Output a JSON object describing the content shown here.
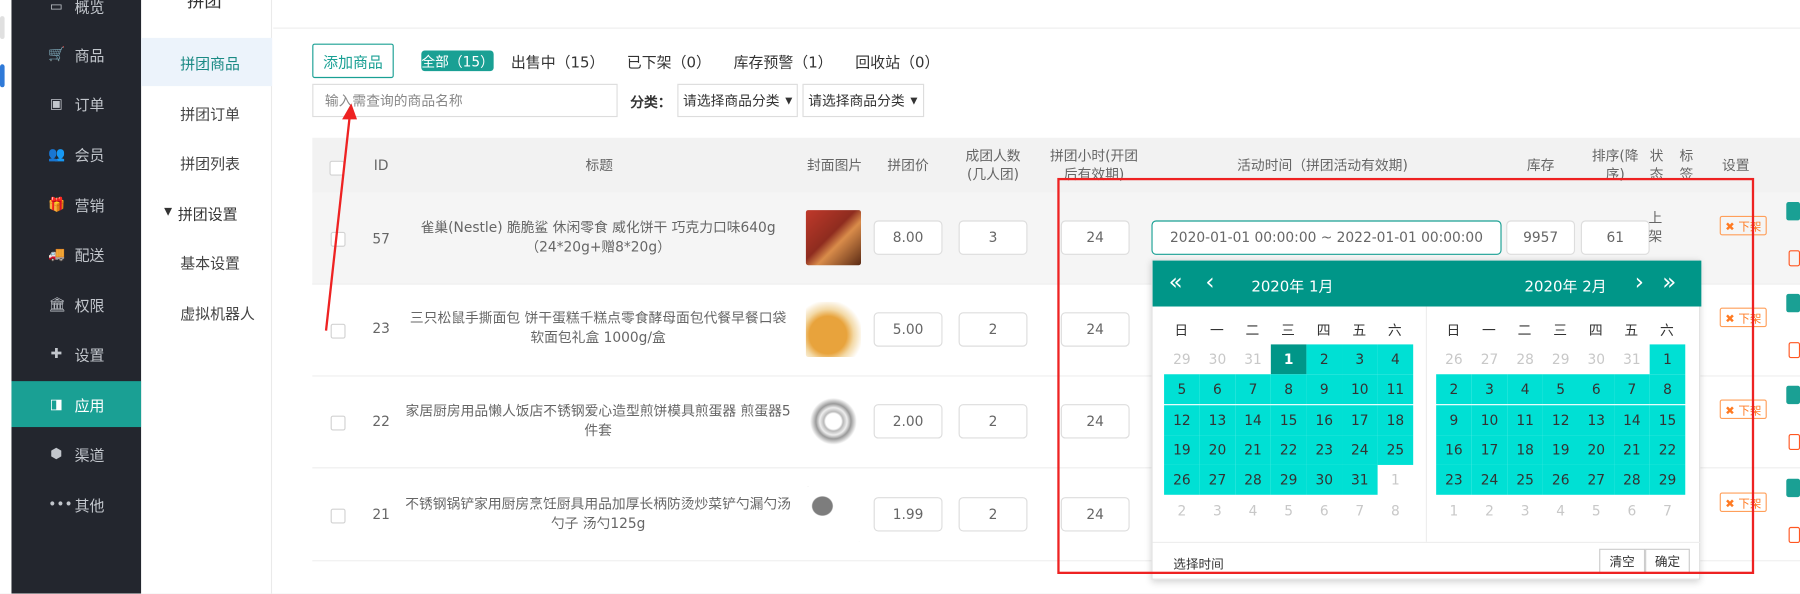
{
  "sidebar": {
    "items": [
      {
        "label": "概览",
        "icon": "monitor-icon",
        "active": false
      },
      {
        "label": "商品",
        "icon": "cart-icon",
        "active": false
      },
      {
        "label": "订单",
        "icon": "money-icon",
        "active": false
      },
      {
        "label": "会员",
        "icon": "users-icon",
        "active": false
      },
      {
        "label": "营销",
        "icon": "gift-icon",
        "active": false
      },
      {
        "label": "配送",
        "icon": "truck-icon",
        "active": false
      },
      {
        "label": "权限",
        "icon": "bank-icon",
        "active": false
      },
      {
        "label": "设置",
        "icon": "puzzle-icon",
        "active": false
      },
      {
        "label": "应用",
        "icon": "app-icon",
        "active": true
      },
      {
        "label": "渠道",
        "icon": "cube-icon",
        "active": false
      },
      {
        "label": "其他",
        "icon": "dots-icon",
        "active": false
      }
    ]
  },
  "subnav": {
    "title": "拼团",
    "items": [
      {
        "label": "拼团商品",
        "active": true
      },
      {
        "label": "拼团订单",
        "active": false
      },
      {
        "label": "拼团列表",
        "active": false
      },
      {
        "label": "拼团设置",
        "group": true
      },
      {
        "label": "基本设置",
        "active": false
      },
      {
        "label": "虚拟机器人",
        "active": false
      }
    ]
  },
  "toolbar": {
    "add_label": "添加商品",
    "tabs": [
      "全部（15）",
      "出售中（15）",
      "已下架（0）",
      "库存预警（1）",
      "回收站（0）"
    ],
    "search_placeholder": "输入需查询的商品名称",
    "category_label": "分类：",
    "category_select1": "请选择商品分类",
    "category_select2": "请选择商品分类"
  },
  "table": {
    "headers": {
      "id": "ID",
      "title": "标题",
      "cover": "封面图片",
      "price": "拼团价",
      "people": "成团人数(几人团)",
      "hours": "拼团小时(开团后有效期)",
      "activity": "活动时间（拼团活动有效期)",
      "stock": "库存",
      "sort": "排序(降序)",
      "status": "状态",
      "tag": "标签",
      "setting": "设置"
    },
    "rows": [
      {
        "id": "57",
        "title": "雀巢(Nestle) 脆脆鲨 休闲零食 威化饼干 巧克力口味640g（24*20g+赠8*20g）",
        "price": "8.00",
        "people": "3",
        "hours": "24",
        "activity": "2020-01-01 00:00:00 ~ 2022-01-01 00:00:00",
        "stock": "9957",
        "sort": "61",
        "status": "上架",
        "tag_btn": "✖ 下架"
      },
      {
        "id": "23",
        "title": "三只松鼠手撕面包 饼干蛋糕千糕点零食酵母面包代餐早餐口袋软面包礼盒 1000g/盒",
        "price": "5.00",
        "people": "2",
        "hours": "24",
        "tag_btn": "✖ 下架"
      },
      {
        "id": "22",
        "title": "家居厨房用品懒人饭店不锈钢爱心造型煎饼模具煎蛋器 煎蛋器5件套",
        "price": "2.00",
        "people": "2",
        "hours": "24",
        "tag_btn": "✖ 下架"
      },
      {
        "id": "21",
        "title": "不锈钢锅铲家用厨房烹饪厨具用品加厚长柄防烫炒菜铲勺漏勺汤勺子 汤勺125g",
        "price": "1.99",
        "people": "2",
        "hours": "24",
        "tag_btn": "✖ 下架"
      }
    ]
  },
  "datepicker": {
    "left_title": "2020年  1月",
    "right_title": "2020年  2月",
    "weekdays": [
      "日",
      "一",
      "二",
      "三",
      "四",
      "五",
      "六"
    ],
    "left_days": [
      "29",
      "30",
      "31",
      "1",
      "2",
      "3",
      "4",
      "5",
      "6",
      "7",
      "8",
      "9",
      "10",
      "11",
      "12",
      "13",
      "14",
      "15",
      "16",
      "17",
      "18",
      "19",
      "20",
      "21",
      "22",
      "23",
      "24",
      "25",
      "26",
      "27",
      "28",
      "29",
      "30",
      "31",
      "1",
      "2",
      "3",
      "4",
      "5",
      "6",
      "7",
      "8"
    ],
    "right_days": [
      "26",
      "27",
      "28",
      "29",
      "30",
      "31",
      "1",
      "2",
      "3",
      "4",
      "5",
      "6",
      "7",
      "8",
      "9",
      "10",
      "11",
      "12",
      "13",
      "14",
      "15",
      "16",
      "17",
      "18",
      "19",
      "20",
      "21",
      "22",
      "23",
      "24",
      "25",
      "26",
      "27",
      "28",
      "29",
      "1",
      "2",
      "3",
      "4",
      "5",
      "6",
      "7"
    ],
    "select_time": "选择时间",
    "clear": "清空",
    "confirm": "确定",
    "nav": {
      "prev_year": "«",
      "prev_month": "‹",
      "next_month": "›",
      "next_year": "»"
    }
  },
  "colors": {
    "sidebar": "#23262e",
    "accent": "#1aa094",
    "picker_header": "#009688",
    "range": "#00e0d4",
    "annotation": "#ee2222"
  }
}
